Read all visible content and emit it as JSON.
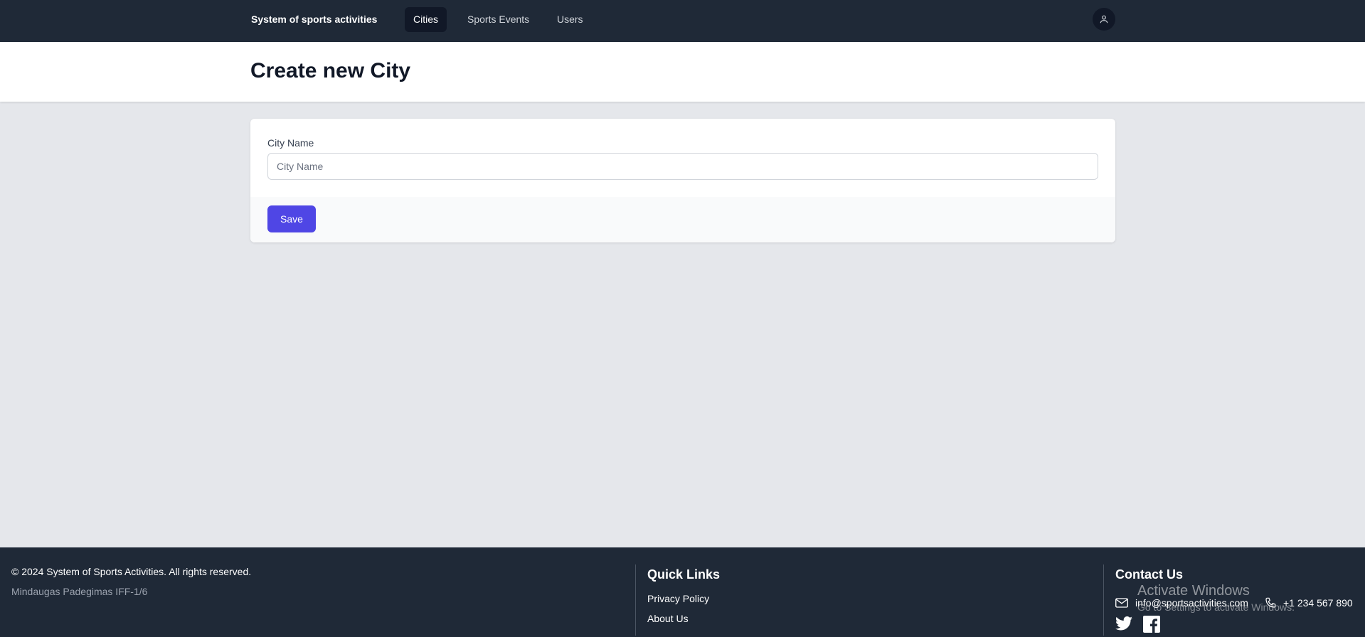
{
  "nav": {
    "brand": "System of sports activities",
    "items": [
      {
        "label": "Cities",
        "active": true
      },
      {
        "label": "Sports Events",
        "active": false
      },
      {
        "label": "Users",
        "active": false
      }
    ],
    "user_icon": "user-icon"
  },
  "header": {
    "title": "Create new City"
  },
  "form": {
    "city_name_label": "City Name",
    "city_name_placeholder": "City Name",
    "city_name_value": "",
    "save_label": "Save"
  },
  "footer": {
    "copyright": "© 2024 System of Sports Activities. All rights reserved.",
    "sub_text": "Mindaugas Padegimas IFF-1/6",
    "quick_links": {
      "heading": "Quick Links",
      "items": [
        "Privacy Policy",
        "About Us"
      ]
    },
    "contact": {
      "heading": "Contact Us",
      "email": "info@sportsactivities.com",
      "phone": "+1 234 567 890",
      "icons": [
        "envelope-icon",
        "phone-icon",
        "twitter-icon",
        "facebook-icon"
      ]
    }
  },
  "watermark": {
    "title": "Activate Windows",
    "subtitle": "Go to Settings to activate Windows."
  },
  "colors": {
    "nav_bg": "#1f2937",
    "accent": "#4f46e5",
    "page_bg": "#e5e7eb"
  }
}
